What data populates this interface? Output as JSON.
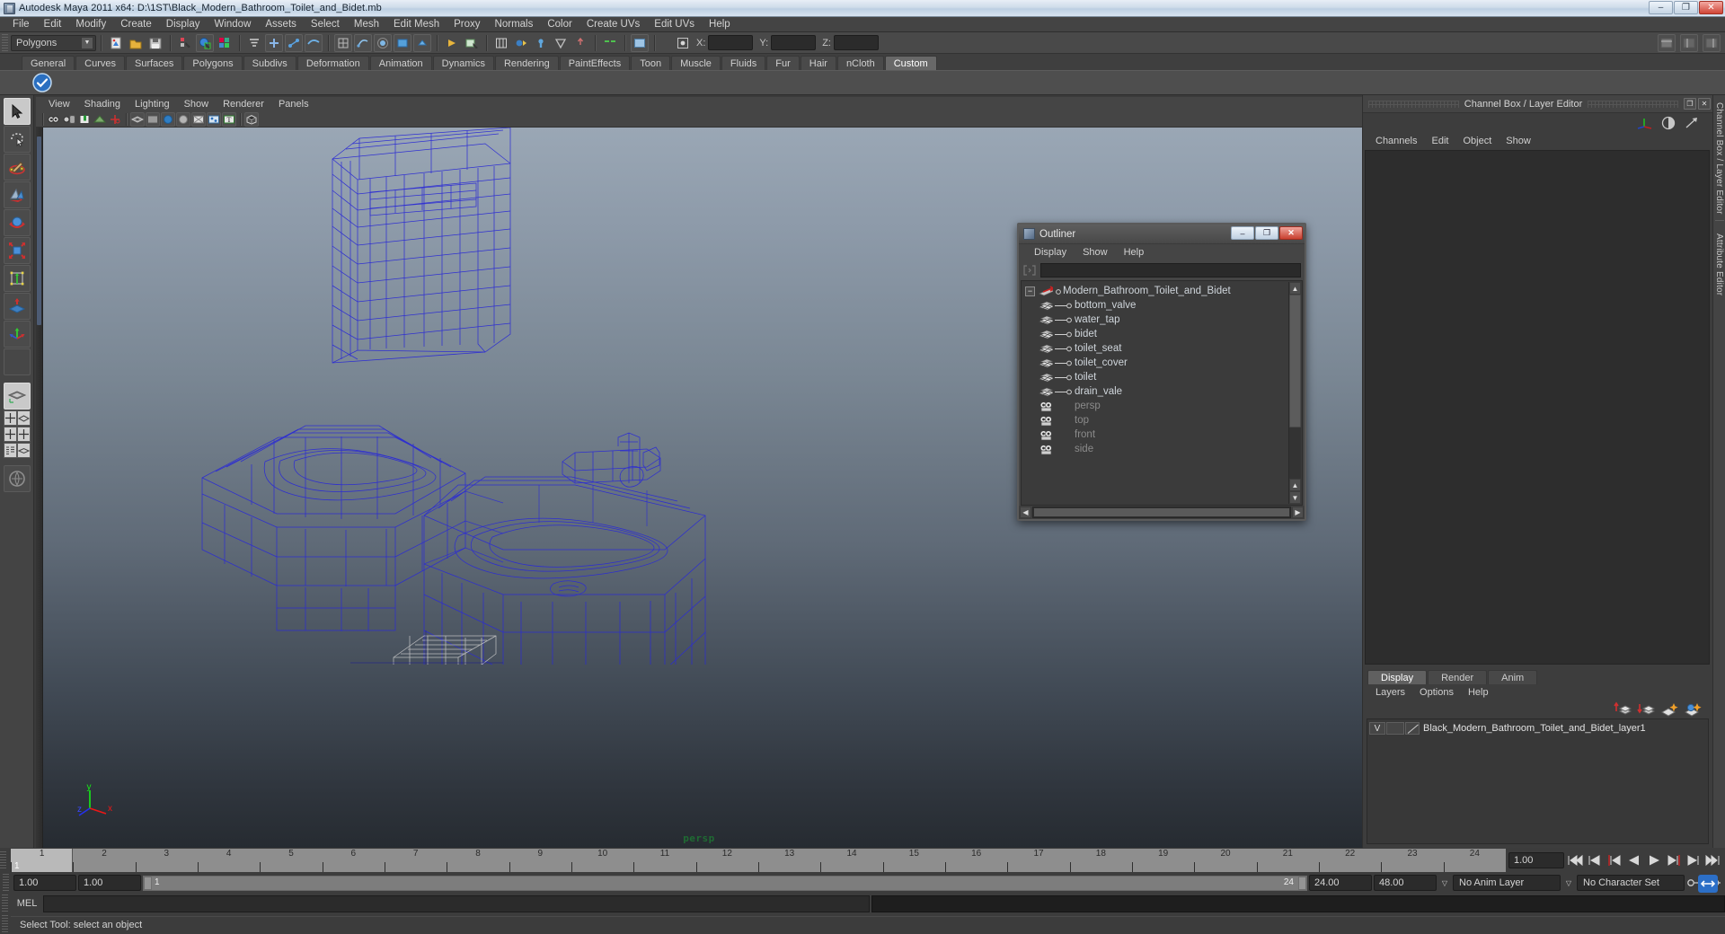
{
  "window": {
    "title": "Autodesk Maya 2011 x64: D:\\1ST\\Black_Modern_Bathroom_Toilet_and_Bidet.mb",
    "icon": "maya-app-icon",
    "minimize": "–",
    "maximize": "❐",
    "close": "✕"
  },
  "menubar": {
    "items": [
      {
        "label": "File"
      },
      {
        "label": "Edit"
      },
      {
        "label": "Modify"
      },
      {
        "label": "Create"
      },
      {
        "label": "Display"
      },
      {
        "label": "Window"
      },
      {
        "label": "Assets"
      },
      {
        "label": "Select"
      },
      {
        "label": "Mesh"
      },
      {
        "label": "Edit Mesh"
      },
      {
        "label": "Proxy"
      },
      {
        "label": "Normals"
      },
      {
        "label": "Color"
      },
      {
        "label": "Create UVs"
      },
      {
        "label": "Edit UVs"
      },
      {
        "label": "Help"
      }
    ]
  },
  "statusline": {
    "selection_mode": "Polygons",
    "coords": {
      "x_label": "X:",
      "y_label": "Y:",
      "z_label": "Z:",
      "x_value": "",
      "y_value": "",
      "z_value": ""
    }
  },
  "shelf": {
    "tabs": [
      {
        "label": "General"
      },
      {
        "label": "Curves"
      },
      {
        "label": "Surfaces"
      },
      {
        "label": "Polygons"
      },
      {
        "label": "Subdivs"
      },
      {
        "label": "Deformation"
      },
      {
        "label": "Animation"
      },
      {
        "label": "Dynamics"
      },
      {
        "label": "Rendering"
      },
      {
        "label": "PaintEffects"
      },
      {
        "label": "Toon"
      },
      {
        "label": "Muscle"
      },
      {
        "label": "Fluids"
      },
      {
        "label": "Fur"
      },
      {
        "label": "Hair"
      },
      {
        "label": "nCloth"
      },
      {
        "label": "Custom"
      }
    ],
    "active_tab": "Custom"
  },
  "viewport": {
    "menus": [
      {
        "label": "View"
      },
      {
        "label": "Shading"
      },
      {
        "label": "Lighting"
      },
      {
        "label": "Show"
      },
      {
        "label": "Renderer"
      },
      {
        "label": "Panels"
      }
    ],
    "camera_label": "persp",
    "axis": {
      "x": "x",
      "y": "y",
      "z": "z",
      "x_color": "#ff2020",
      "y_color": "#20ff20",
      "z_color": "#2040ff"
    },
    "model_wireframe_color": "#2b2bd4",
    "background_top": "#9aa7b5",
    "background_bottom": "#262b31"
  },
  "outliner": {
    "title": "Outliner",
    "icon": "outliner-window-icon",
    "window_buttons": {
      "minimize": "–",
      "maximize": "❐",
      "close": "✕"
    },
    "menus": [
      {
        "label": "Display"
      },
      {
        "label": "Show"
      },
      {
        "label": "Help"
      }
    ],
    "search_value": "",
    "search_placeholder": "",
    "tree": [
      {
        "label": "Modern_Bathroom_Toilet_and_Bidet",
        "type": "group",
        "icon": "transform-icon",
        "expanded": true,
        "depth": 0,
        "dim": false
      },
      {
        "label": "bottom_valve",
        "type": "mesh",
        "icon": "mesh-icon",
        "depth": 1,
        "dim": false
      },
      {
        "label": "water_tap",
        "type": "mesh",
        "icon": "mesh-icon",
        "depth": 1,
        "dim": false
      },
      {
        "label": "bidet",
        "type": "mesh",
        "icon": "mesh-icon",
        "depth": 1,
        "dim": false
      },
      {
        "label": "toilet_seat",
        "type": "mesh",
        "icon": "mesh-icon",
        "depth": 1,
        "dim": false
      },
      {
        "label": "toilet_cover",
        "type": "mesh",
        "icon": "mesh-icon",
        "depth": 1,
        "dim": false
      },
      {
        "label": "toilet",
        "type": "mesh",
        "icon": "mesh-icon",
        "depth": 1,
        "dim": false
      },
      {
        "label": "drain_vale",
        "type": "mesh",
        "icon": "mesh-icon",
        "depth": 1,
        "dim": false
      },
      {
        "label": "persp",
        "type": "camera",
        "icon": "camera-icon",
        "depth": 1,
        "dim": true
      },
      {
        "label": "top",
        "type": "camera",
        "icon": "camera-icon",
        "depth": 1,
        "dim": true
      },
      {
        "label": "front",
        "type": "camera",
        "icon": "camera-icon",
        "depth": 1,
        "dim": true
      },
      {
        "label": "side",
        "type": "camera",
        "icon": "camera-icon",
        "depth": 1,
        "dim": true
      }
    ]
  },
  "channelbox": {
    "title": "Channel Box / Layer Editor",
    "menus": [
      {
        "label": "Channels"
      },
      {
        "label": "Edit"
      },
      {
        "label": "Object"
      },
      {
        "label": "Show"
      }
    ],
    "buttons": {
      "float": "❐",
      "close": "✕"
    },
    "sidebar_label": "Channel Box / Layer Editor",
    "attribute_editor_label": "Attribute Editor"
  },
  "layereditor": {
    "tabs": [
      {
        "label": "Display"
      },
      {
        "label": "Render"
      },
      {
        "label": "Anim"
      }
    ],
    "active_tab": "Display",
    "menus": [
      {
        "label": "Layers"
      },
      {
        "label": "Options"
      },
      {
        "label": "Help"
      }
    ],
    "layers": [
      {
        "visible": "V",
        "playback": "",
        "name": "Black_Modern_Bathroom_Toilet_and_Bidet_layer1"
      }
    ]
  },
  "timeline": {
    "frames": [
      1,
      2,
      3,
      4,
      5,
      6,
      7,
      8,
      9,
      10,
      11,
      12,
      13,
      14,
      15,
      16,
      17,
      18,
      19,
      20,
      21,
      22,
      23,
      24
    ],
    "current_frame": "1",
    "start": 1,
    "end": 24,
    "playback_speed": "1.00"
  },
  "rangeslider": {
    "anim_start": "1.00",
    "range_start": "1.00",
    "bar_left": "1",
    "bar_right": "24",
    "range_end": "24.00",
    "anim_end": "48.00",
    "anim_layer": "No Anim Layer",
    "character_set": "No Character Set"
  },
  "mel": {
    "label": "MEL",
    "command_value": ""
  },
  "statusbar": {
    "message": "Select Tool: select an object",
    "help_icon": "help-arrows-icon"
  },
  "toolbox": {
    "tools": [
      {
        "name": "select-tool",
        "active": true
      },
      {
        "name": "lasso-tool",
        "active": false
      },
      {
        "name": "paint-select-tool",
        "active": false
      },
      {
        "name": "move-tool",
        "active": false
      },
      {
        "name": "rotate-tool",
        "active": false
      },
      {
        "name": "scale-tool",
        "active": false
      },
      {
        "name": "universal-manipulator",
        "active": false
      },
      {
        "name": "soft-modification-tool",
        "active": false
      },
      {
        "name": "last-tool",
        "active": false
      },
      {
        "name": "blank-tool",
        "active": false
      }
    ]
  }
}
